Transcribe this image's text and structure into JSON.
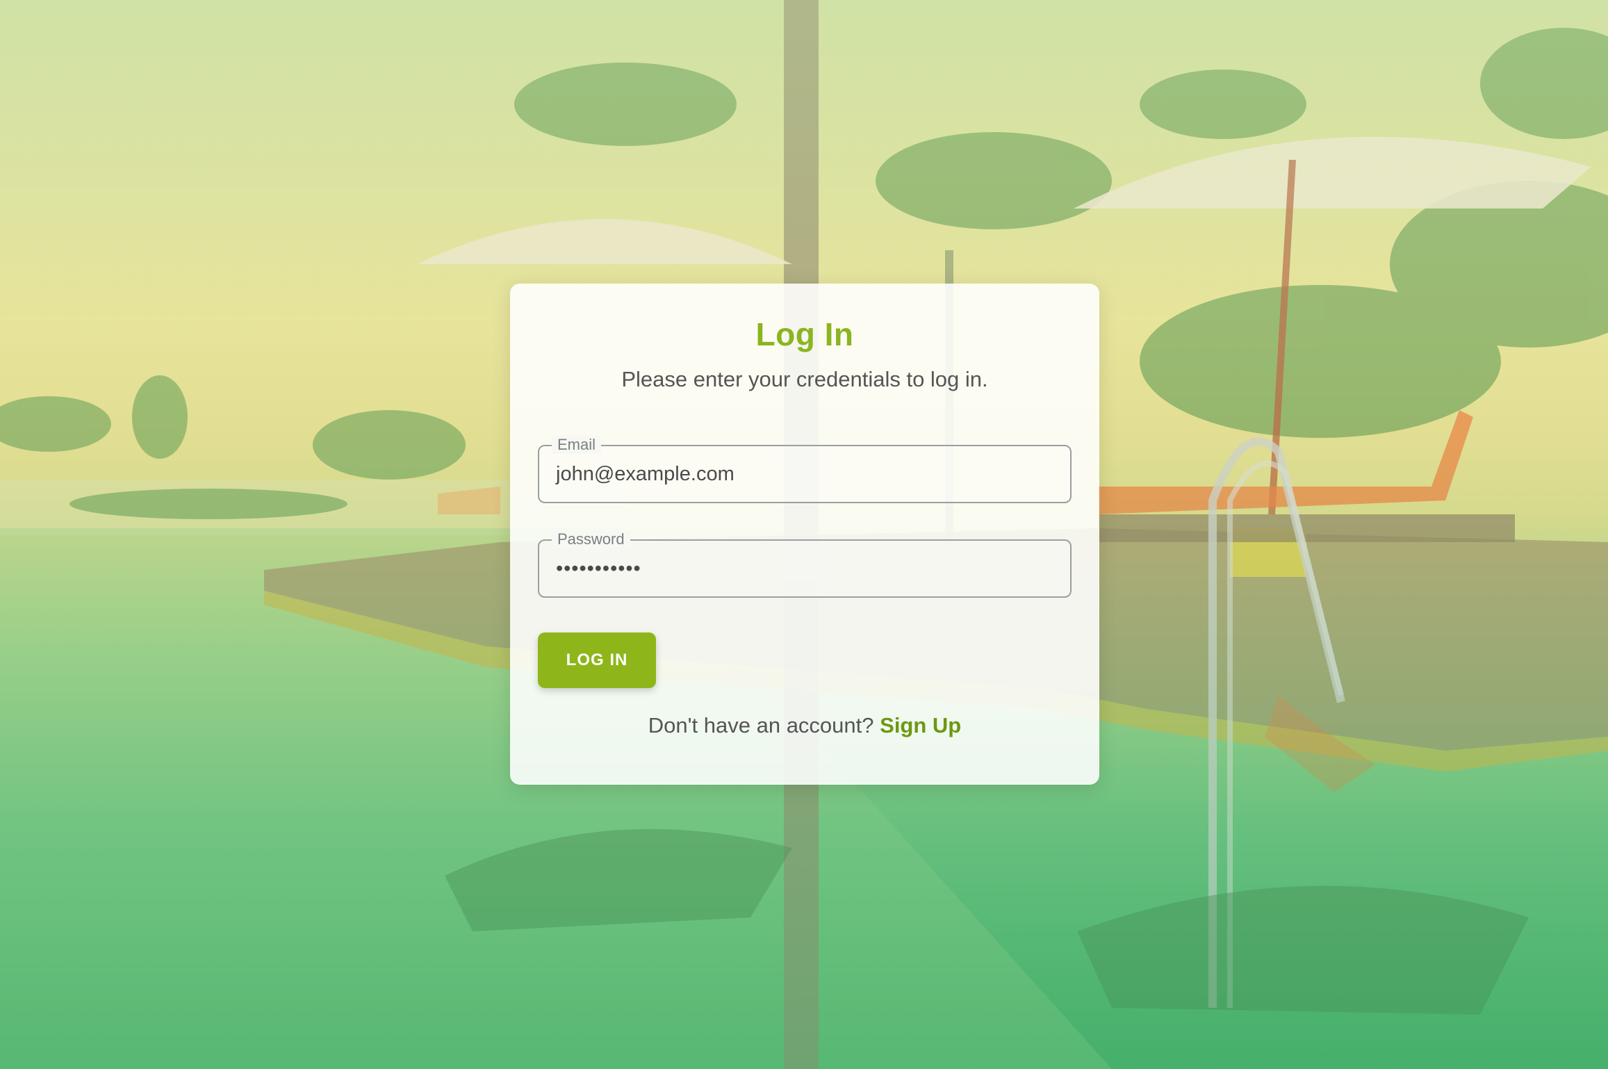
{
  "login": {
    "title": "Log In",
    "subtitle": "Please enter your credentials to log in.",
    "email": {
      "label": "Email",
      "value": "john@example.com"
    },
    "password": {
      "label": "Password",
      "value": "•••••••••••"
    },
    "button_label": "LOG IN",
    "signup_prompt": "Don't have an account?",
    "signup_link": "Sign Up"
  },
  "colors": {
    "accent": "#8eb61a",
    "title": "#8ab51f",
    "link": "#6e9712"
  }
}
